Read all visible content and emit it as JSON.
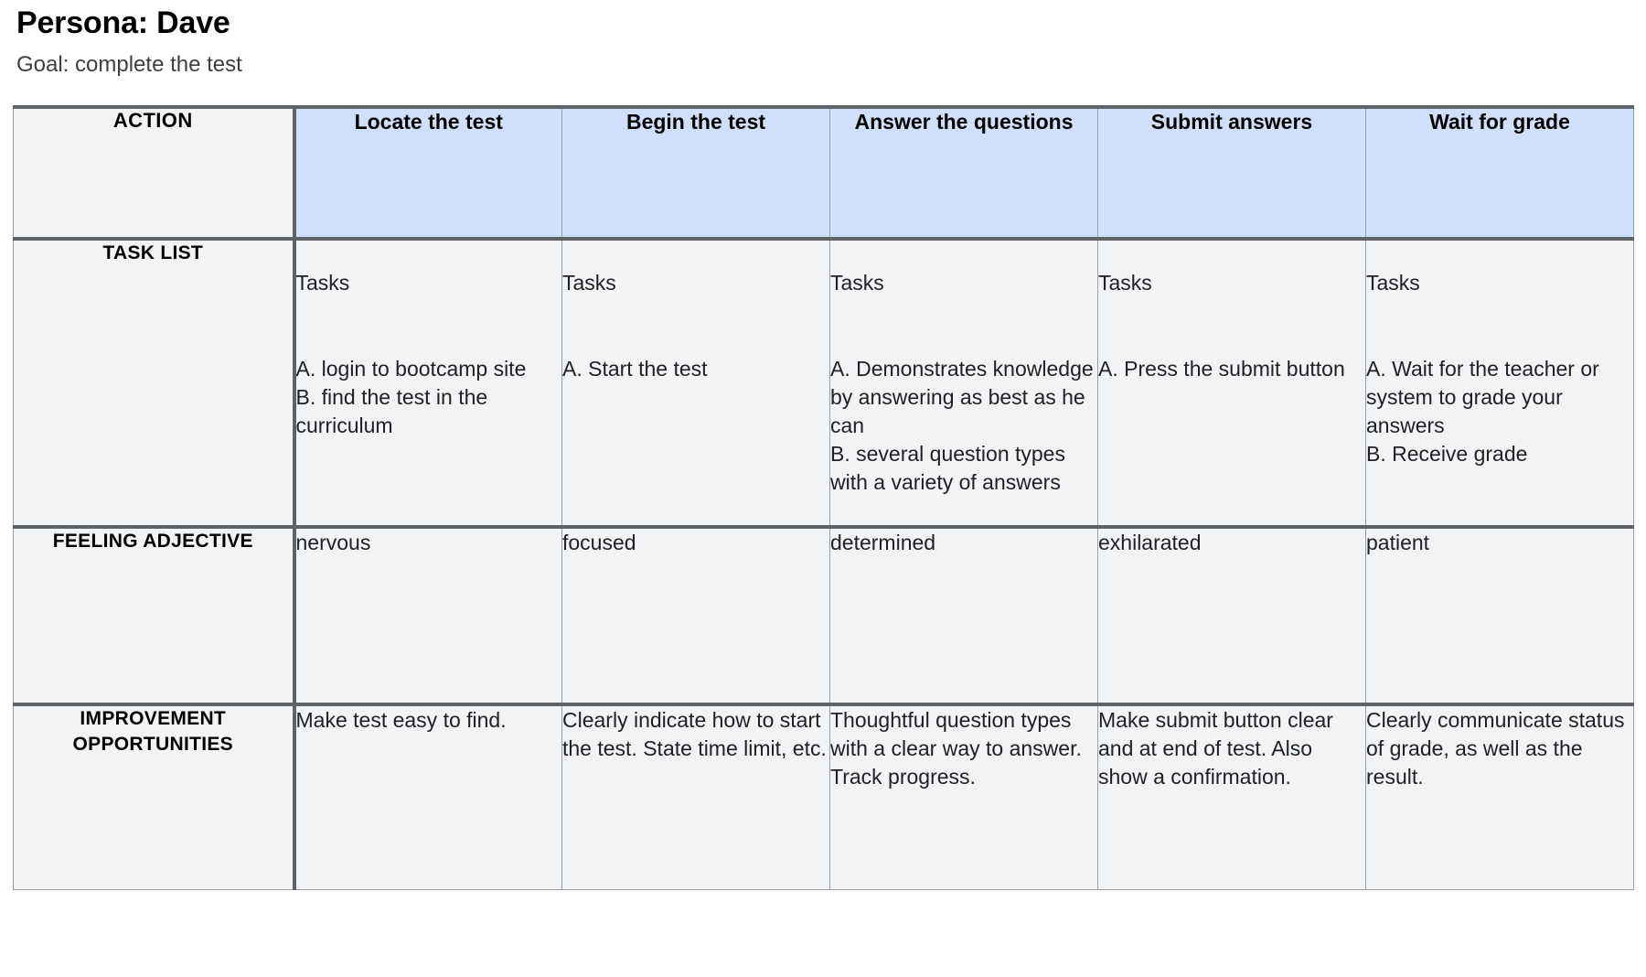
{
  "persona": {
    "title": "Persona: Dave",
    "goal": "Goal: complete the test"
  },
  "table": {
    "row_labels": {
      "action": "ACTION",
      "task_list": "TASK LIST",
      "feeling_adjective": "FEELING ADJECTIVE",
      "improvement_opportunities": "IMPROVEMENT OPPORTUNITIES"
    },
    "header_accent_color": "#cfe0fb",
    "cell_background_color": "#f1f3f4",
    "border_color": "#5f6368",
    "columns": [
      {
        "action": "Locate the test",
        "tasks_heading": "Tasks",
        "tasks_body": "A. login to bootcamp site\nB. find the test in the curriculum",
        "feeling": "nervous",
        "improvement": "Make test easy to find."
      },
      {
        "action": "Begin the test",
        "tasks_heading": "Tasks",
        "tasks_body": "A. Start the test",
        "feeling": "focused",
        "improvement": "Clearly indicate how to start the test. State time limit, etc."
      },
      {
        "action": "Answer the questions",
        "tasks_heading": "Tasks",
        "tasks_body": "A. Demonstrates knowledge by answering as best as he can\nB. several question types with a variety of answers",
        "feeling": "determined",
        "improvement": "Thoughtful question types with a clear way to answer. Track progress."
      },
      {
        "action": "Submit answers",
        "tasks_heading": "Tasks",
        "tasks_body": "A. Press the submit button",
        "feeling": "exhilarated",
        "improvement": "Make submit button clear and at end of test. Also show a confirmation."
      },
      {
        "action": "Wait for grade",
        "tasks_heading": "Tasks",
        "tasks_body": "A. Wait for the teacher or system to grade your answers\nB. Receive grade",
        "feeling": "patient",
        "improvement": "Clearly communicate status of grade, as well as the result."
      }
    ]
  }
}
